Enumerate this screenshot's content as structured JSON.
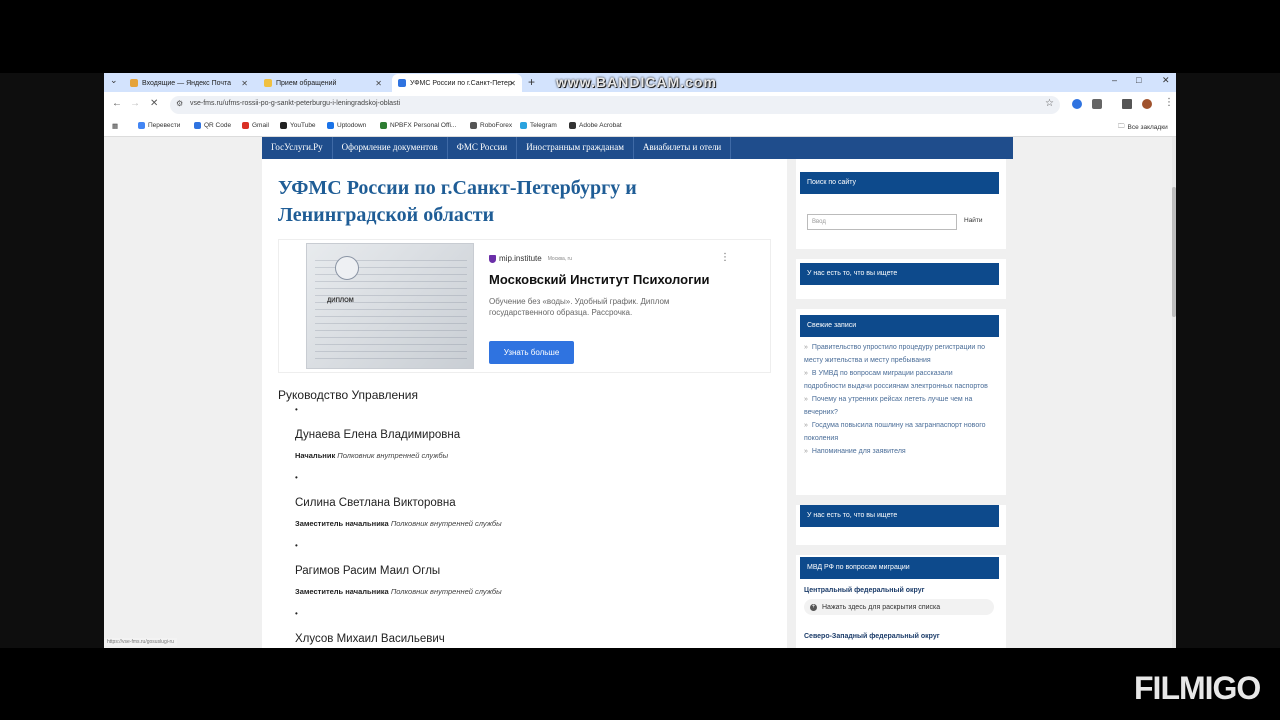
{
  "browser": {
    "tabs": [
      {
        "label": "Входящие — Яндекс Почта",
        "favicon_color": "#e5a33a"
      },
      {
        "label": "Прием обращений",
        "favicon_color": "#f0c040"
      },
      {
        "label": "УФМС России по г.Санкт-Петер",
        "favicon_color": "#2f73e0"
      }
    ],
    "new_tab_symbol": "+",
    "url": "vse-fms.ru/ufms-rossii-po-g-sankt-peterburgu-i-leningradskoj-oblasti",
    "window_controls": [
      "–",
      "□",
      "✕"
    ],
    "bookmarks": [
      {
        "label": "Перевести",
        "color": "#4285f4"
      },
      {
        "label": "QR Code",
        "color": "#2f73e0"
      },
      {
        "label": "Gmail",
        "color": "#d93025"
      },
      {
        "label": "YouTube",
        "color": "#222"
      },
      {
        "label": "Uptodown",
        "color": "#1a73e8"
      },
      {
        "label": "NPBFX Personal Offi...",
        "color": "#2e7d32"
      },
      {
        "label": "RoboForex",
        "color": "#555"
      },
      {
        "label": "Telegram",
        "color": "#2aa3df"
      },
      {
        "label": "Adobe Acrobat",
        "color": "#333"
      }
    ],
    "all_bookmarks": "Все закладки"
  },
  "watermarks": {
    "bandicam": "www.BANDICAM.com",
    "filmigo": "FILMIGO"
  },
  "site": {
    "nav": [
      "ГосУслуги.Ру",
      "Оформление документов",
      "ФМС России",
      "Иностранным гражданам",
      "Авиабилеты и отели"
    ],
    "title": "УФМС России по г.Санкт-Петербургу и Ленинградской области",
    "ad": {
      "brand": "mip.institute",
      "location": "Москва, ru",
      "heading": "Московский Институт Психологии",
      "description": "Обучение без «воды». Удобный график. Диплом государственного образца. Рассрочка.",
      "cta": "Узнать больше",
      "diploma_text": "ДИПЛОМ"
    },
    "section_title": "Руководство Управления",
    "people": [
      {
        "name": "Дунаева Елена Владимировна",
        "role": "Начальник",
        "rank": "Полковник внутренней службы"
      },
      {
        "name": "Силина Светлана Викторовна",
        "role": "Заместитель начальника",
        "rank": "Полковник внутренней службы"
      },
      {
        "name": "Рагимов Расим Маил Оглы",
        "role": "Заместитель начальника",
        "rank": "Полковник внутренней службы"
      },
      {
        "name": "Хлусов Михаил Васильевич",
        "role": "",
        "rank": ""
      }
    ],
    "status_url": "https://vse-fms.ru/gosuslugi-ru"
  },
  "sidebar": {
    "search_title": "Поиск по сайту",
    "search_placeholder": "Ввод",
    "search_button": "Найти",
    "find_title": "У нас есть то, что вы ищете",
    "recent_title": "Свежие записи",
    "recent_posts": [
      "Правительство упростило процедуру регистрации по месту жительства и месту пребывания",
      "В УМВД по вопросам миграции рассказали подробности выдачи россиянам электронных паспортов",
      "Почему на утренних рейсах лететь лучше чем на вечерних?",
      "Госдума повысила пошлину на загранпаспорт нового поколения",
      "Напоминание для заявителя"
    ],
    "find_title_2": "У нас есть то, что вы ищете",
    "mvd_title": "МВД РФ по вопросам миграции",
    "region_1": "Центральный федеральный округ",
    "expand_label": "Нажать здесь для раскрытия списка",
    "region_2": "Северо-Западный федеральный округ"
  }
}
